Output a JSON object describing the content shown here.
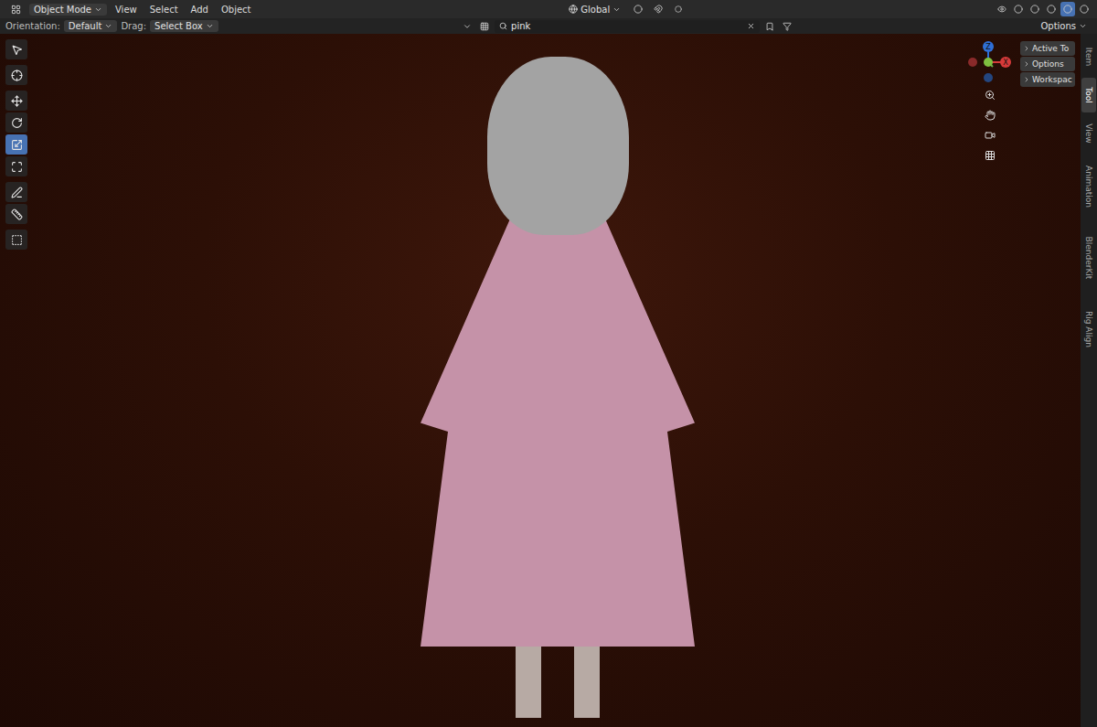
{
  "header": {
    "mode": "Object Mode",
    "menus": [
      "View",
      "Select",
      "Add",
      "Object"
    ],
    "orientation": "Global"
  },
  "tool_settings": {
    "orientation_label": "Orientation:",
    "orientation": "Default",
    "drag_label": "Drag:",
    "drag": "Select Box",
    "search": "pink",
    "options": "Options"
  },
  "tools": [
    {
      "kind": "select",
      "selected": false
    },
    {
      "kind": "cursor",
      "selected": false
    },
    {
      "kind": "move",
      "selected": false
    },
    {
      "kind": "rotate",
      "selected": false
    },
    {
      "kind": "scale",
      "selected": true
    },
    {
      "kind": "transform",
      "selected": false
    },
    {
      "kind": "annotate",
      "selected": false
    },
    {
      "kind": "measure",
      "selected": false
    },
    {
      "kind": "add",
      "selected": false
    }
  ],
  "gizmo": {
    "axes": [
      {
        "label": "Z",
        "color": "#2f6fd6"
      },
      {
        "label": "X",
        "color": "#d63a3a"
      }
    ]
  },
  "n_panel": {
    "sections": [
      {
        "label": "Active To",
        "expanded": false
      },
      {
        "label": "Options",
        "expanded": false
      },
      {
        "label": "Workspac",
        "expanded": false
      }
    ]
  },
  "side_tabs": [
    {
      "label": "Item",
      "selected": false
    },
    {
      "label": "Tool",
      "selected": true
    },
    {
      "label": "View",
      "selected": false
    },
    {
      "label": "Animation",
      "selected": false
    },
    {
      "label": "BlenderKit",
      "selected": false
    },
    {
      "label": "Rig Align",
      "selected": false
    }
  ]
}
